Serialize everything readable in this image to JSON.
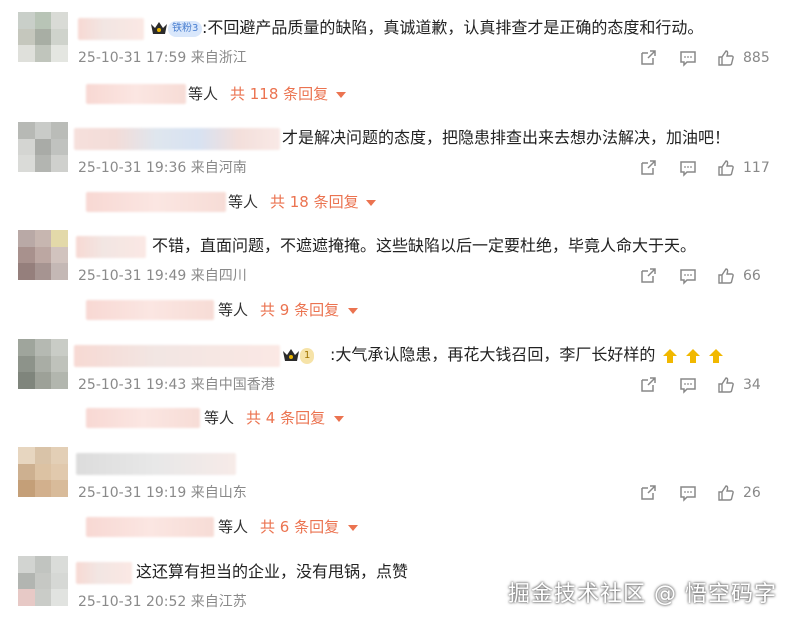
{
  "comments": [
    {
      "text": ":不回避产品质量的缺陷，真诚道歉，认真排查才是正确的态度和行动。",
      "fan_badge": "铁粉3",
      "timestamp": "25-10-31 17:59",
      "location": "来自浙江",
      "likes": "885",
      "reply_label": "等人",
      "reply_count": "共 118 条回复"
    },
    {
      "text": "才是解决问题的态度，把隐患排查出来去想办法解决，加油吧！",
      "timestamp": "25-10-31 19:36",
      "location": "来自河南",
      "likes": "117",
      "reply_label": "等人",
      "reply_count": "共 18 条回复"
    },
    {
      "text": "不错，直面问题，不遮遮掩掩。这些缺陷以后一定要杜绝，毕竟人命大于天。",
      "timestamp": "25-10-31 19:49",
      "location": "来自四川",
      "likes": "66",
      "reply_label": "等人",
      "reply_count": "共 9 条回复"
    },
    {
      "text": ":大气承认隐患，再花大钱召回，李厂长好样的",
      "fan_badge": "1",
      "timestamp": "25-10-31 19:43",
      "location": "来自中国香港",
      "likes": "34",
      "reply_label": "等人",
      "reply_count": "共 4 条回复"
    },
    {
      "text": "",
      "timestamp": "25-10-31 19:19",
      "location": "来自山东",
      "likes": "26",
      "reply_label": "等人",
      "reply_count": "共 6 条回复"
    },
    {
      "text": "这还算有担当的企业，没有甩锅，点赞",
      "timestamp": "25-10-31 20:52",
      "location": "来自江苏"
    }
  ],
  "watermark": "掘金技术社区 @ 悟空码字",
  "colors": {
    "accent": "#eb7350",
    "meta_text": "#8a8a8a",
    "icon": "#888888"
  }
}
